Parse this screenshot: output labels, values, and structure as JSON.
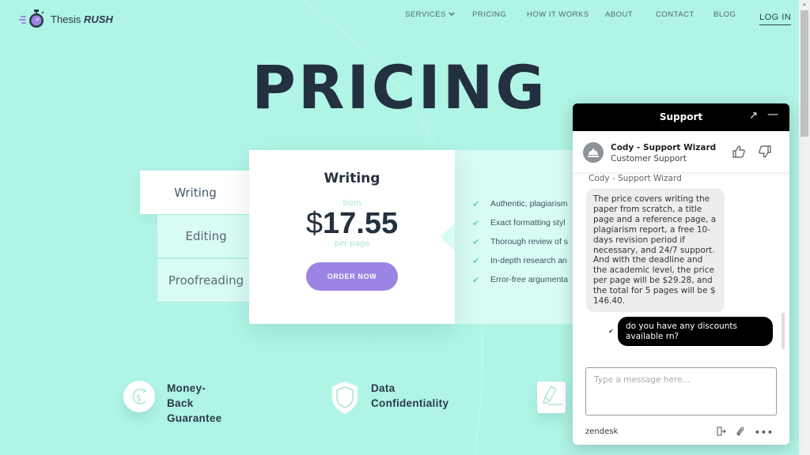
{
  "header": {
    "logo": {
      "brand_light": "Thesis",
      "brand_bold": "RUSH"
    },
    "nav": [
      {
        "label": "SERVICES",
        "has_dropdown": true
      },
      {
        "label": "PRICING"
      },
      {
        "label": "HOW IT WORKS"
      },
      {
        "label": "ABOUT"
      },
      {
        "label": "CONTACT"
      },
      {
        "label": "BLOG"
      }
    ],
    "login_label": "LOG IN"
  },
  "page_title": "PRICING",
  "pricing": {
    "tabs": [
      {
        "label": "Writing",
        "active": true
      },
      {
        "label": "Editing",
        "active": false
      },
      {
        "label": "Proofreading",
        "active": false
      }
    ],
    "card": {
      "title": "Writing",
      "from_label": "from",
      "currency": "$",
      "price": "17.55",
      "per_label": "per page",
      "order_button": "ORDER NOW"
    },
    "features": [
      "Authentic, plagiarism",
      "Exact formatting styl",
      "Thorough review of s",
      "In-depth research an",
      "Error-free argumenta"
    ]
  },
  "benefits": [
    {
      "icon": "money-back-icon",
      "text_lines": [
        "Money-",
        "Back",
        "Guarantee"
      ]
    },
    {
      "icon": "shield-icon",
      "text_lines": [
        "Data",
        "Confidentiality"
      ]
    },
    {
      "icon": "highlighter-icon",
      "text_lines": []
    }
  ],
  "chat": {
    "title": "Support",
    "agent_name": "Cody - Support Wizard",
    "agent_role": "Customer Support",
    "sender_label": "Cody - Support Wizard",
    "agent_message": "The price covers writing the paper from scratch, a title page and a reference page, a plagiarism report, a free 10-days revision period if necessary, and 24/7 support. And with the deadline and the academic level, the price per page will be $29.28, and the total for 5 pages will be $ 146.40.",
    "user_message": "do you have any discounts available rn?",
    "input_value": "",
    "input_placeholder": "Type a message here...",
    "brand": "zendesk"
  },
  "colors": {
    "background": "#b0f4e6",
    "accent_purple": "#9b84e4",
    "dark_text": "#23303f",
    "mint_panel": "#d8fbf4"
  }
}
